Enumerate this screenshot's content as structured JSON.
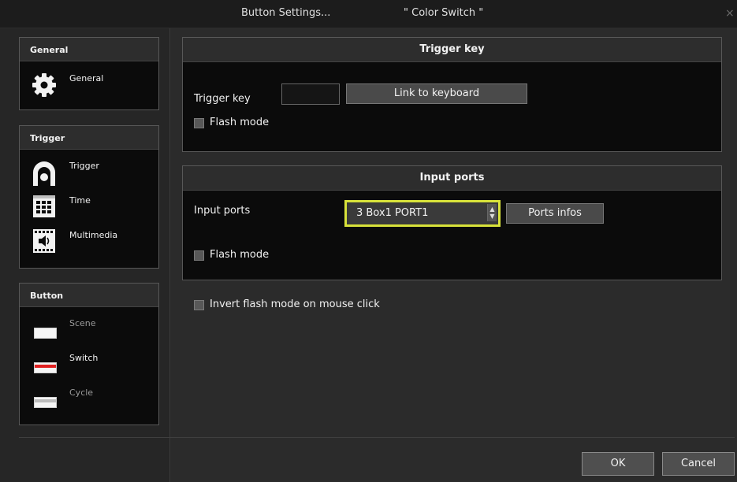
{
  "window": {
    "title": "Button Settings...",
    "subtitle": "\" Color Switch \"",
    "close_glyph": "×"
  },
  "sidebar": {
    "general": {
      "header": "General",
      "items": [
        {
          "label": "General",
          "icon": "gear-icon"
        }
      ]
    },
    "trigger": {
      "header": "Trigger",
      "items": [
        {
          "label": "Trigger",
          "icon": "trigger-arch-icon"
        },
        {
          "label": "Time",
          "icon": "calendar-icon"
        },
        {
          "label": "Multimedia",
          "icon": "multimedia-speaker-icon"
        }
      ]
    },
    "button": {
      "header": "Button",
      "items": [
        {
          "label": "Scene",
          "icon": "scene-swatch-icon",
          "stripe": "none",
          "active": false
        },
        {
          "label": "Switch",
          "icon": "switch-swatch-icon",
          "stripe": "#e02020",
          "active": true
        },
        {
          "label": "Cycle",
          "icon": "cycle-swatch-icon",
          "stripe": "#cfcfcf",
          "active": true
        }
      ]
    }
  },
  "trigger_key": {
    "header": "Trigger key",
    "label": "Trigger key",
    "key_value": "",
    "link_button": "Link to keyboard",
    "flash_mode": {
      "label": "Flash mode",
      "checked": false
    }
  },
  "input_ports": {
    "header": "Input ports",
    "label": "Input ports",
    "selected_port": "3  Box1  PORT1",
    "ports_info_button": "Ports infos",
    "flash_mode": {
      "label": "Flash mode",
      "checked": false
    }
  },
  "invert_flash": {
    "label": "Invert flash mode on mouse click",
    "checked": false
  },
  "footer": {
    "ok": "OK",
    "cancel": "Cancel"
  },
  "colors": {
    "highlight": "#d8e23a",
    "switch_stripe": "#e02020",
    "panel_bg": "#0b0b0b"
  }
}
